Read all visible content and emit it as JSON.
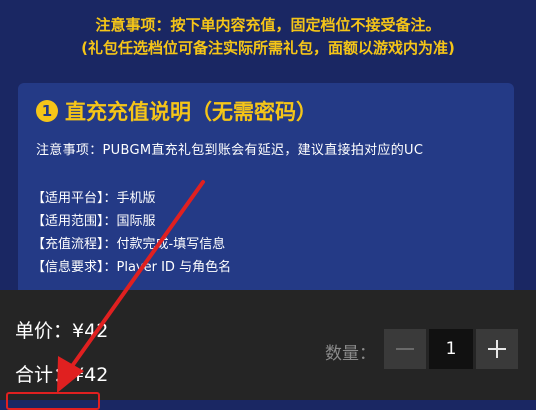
{
  "notice": {
    "line1": "注意事项：按下单内容充值，固定档位不接受备注。",
    "line2": "(礼包任选档位可备注实际所需礼包，面额以游戏内为准)"
  },
  "card": {
    "number": "1",
    "title": "直充充值说明（无需密码）",
    "note": "注意事项：PUBGM直充礼包到账会有延迟，建议直接拍对应的UC",
    "rows": [
      {
        "key": "【适用平台】",
        "value": "：手机版"
      },
      {
        "key": "【适用范围】",
        "value": "：国际服"
      },
      {
        "key": "【充值流程】",
        "value": "：付款完成-填写信息"
      },
      {
        "key": "【信息要求】",
        "value": "：Player ID 与角色名"
      }
    ]
  },
  "order": {
    "unit_price_label": "单价：",
    "unit_price": "¥42",
    "total_label": "合计：",
    "total": "¥42",
    "quantity_label": "数量：",
    "quantity": "1"
  },
  "colors": {
    "background": "#1a2763",
    "card": "#243a86",
    "accent_yellow": "#f5c518",
    "annotation_red": "#e02020",
    "bottom_bar": "#252525"
  }
}
